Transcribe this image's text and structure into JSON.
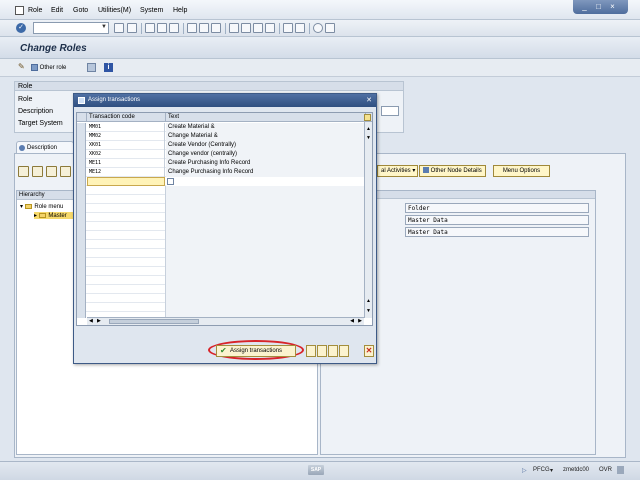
{
  "menubar": {
    "items": [
      "Role",
      "Edit",
      "Goto",
      "Utilities(M)",
      "System",
      "Help"
    ]
  },
  "header": {
    "title": "Change Roles"
  },
  "apptoolbar": {
    "other_role": "Other role"
  },
  "role_box": {
    "header": "Role",
    "labels": [
      "Role",
      "Description",
      "Target System"
    ]
  },
  "tabs": {
    "description": "Description"
  },
  "right_buttons": {
    "functional_activities": "al Activities",
    "other_node_details": "Other Node Details",
    "menu_options": "Menu Options"
  },
  "hierarchy": {
    "header": "Hierarchy",
    "root": "Role menu",
    "child": "Master"
  },
  "details": {
    "values": [
      "Folder",
      "Master Data",
      "Master Data"
    ]
  },
  "dialog": {
    "title": "Assign transactions",
    "columns": [
      "Transaction code",
      "Text"
    ],
    "rows": [
      {
        "code": "MM01",
        "text": "Create Material &"
      },
      {
        "code": "MM02",
        "text": "Change Material &"
      },
      {
        "code": "XK01",
        "text": "Create Vendor (Centrally)"
      },
      {
        "code": "XK02",
        "text": "Change vendor (centrally)"
      },
      {
        "code": "ME11",
        "text": "Create Purchasing Info Record"
      },
      {
        "code": "ME12",
        "text": "Change Purchasing Info Record"
      }
    ],
    "assign_button": "Assign transactions"
  },
  "statusbar": {
    "system": "PFCG",
    "client": "zmetdc00",
    "mode": "OVR",
    "logo": "SAP"
  },
  "colors": {
    "dialog_title": "#2f4f80",
    "highlight": "#d8242a",
    "active_input": "#fff3b8"
  }
}
